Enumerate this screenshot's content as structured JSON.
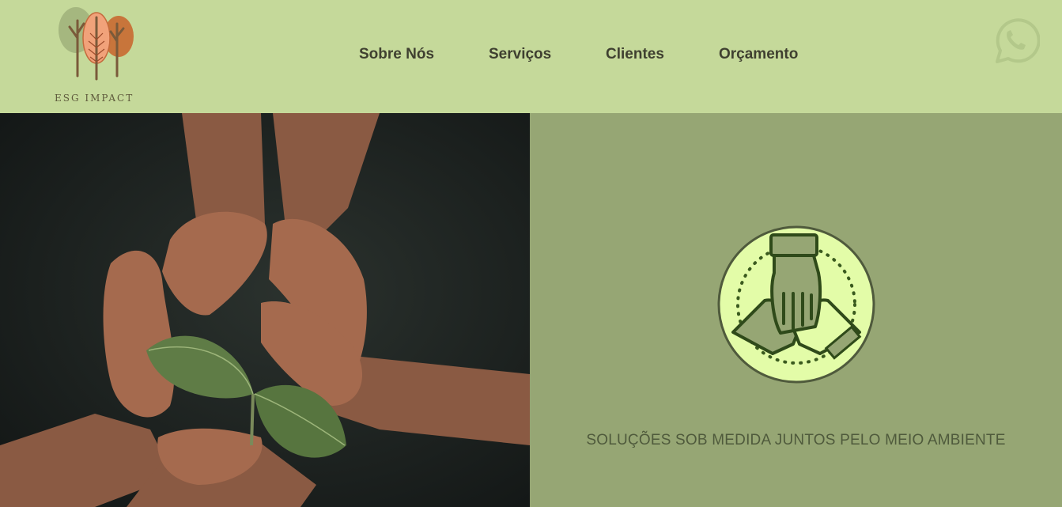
{
  "brand": {
    "name": "ESG IMPACT",
    "logo_icon": "three-trees-icon"
  },
  "nav": {
    "items": [
      {
        "label": "Sobre Nós"
      },
      {
        "label": "Serviços"
      },
      {
        "label": "Clientes"
      },
      {
        "label": "Orçamento"
      }
    ]
  },
  "whatsapp": {
    "icon": "whatsapp-icon"
  },
  "hero": {
    "image": "hands-around-seedling-photo",
    "badge_icon": "joined-hands-icon",
    "tagline": "SOLUÇÕES SOB MEDIDA JUNTOS PELO MEIO AMBIENTE"
  },
  "colors": {
    "header_bg": "#c5d99a",
    "panel_bg": "#96a674",
    "badge_bg": "#e3fca8",
    "text_dark": "#3f4030"
  }
}
